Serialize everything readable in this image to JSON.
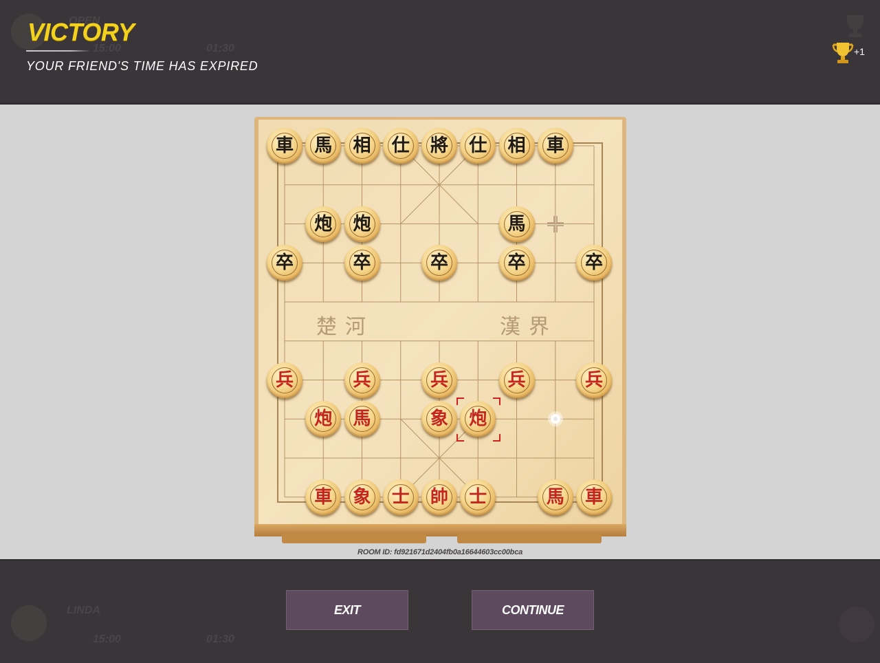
{
  "header": {
    "title": "VICTORY",
    "subtitle": "YOUR FRIEND'S TIME HAS EXPIRED",
    "trophy_reward": "+1",
    "ghost_opponent_name": "OPEN",
    "ghost_opponent_total_time": "15:00",
    "ghost_opponent_move_time": "01:30",
    "colors": {
      "title": "#f2d21e",
      "bar": "#3a3539"
    }
  },
  "board": {
    "river_left": "楚河",
    "river_right": "漢界",
    "pieces": [
      {
        "side": "black",
        "char": "車",
        "col": 0,
        "row": 0
      },
      {
        "side": "black",
        "char": "馬",
        "col": 1,
        "row": 0
      },
      {
        "side": "black",
        "char": "相",
        "col": 2,
        "row": 0
      },
      {
        "side": "black",
        "char": "仕",
        "col": 3,
        "row": 0
      },
      {
        "side": "black",
        "char": "將",
        "col": 4,
        "row": 0
      },
      {
        "side": "black",
        "char": "仕",
        "col": 5,
        "row": 0
      },
      {
        "side": "black",
        "char": "相",
        "col": 6,
        "row": 0
      },
      {
        "side": "black",
        "char": "車",
        "col": 7,
        "row": 0
      },
      {
        "side": "black",
        "char": "炮",
        "col": 1,
        "row": 2
      },
      {
        "side": "black",
        "char": "炮",
        "col": 2,
        "row": 2
      },
      {
        "side": "black",
        "char": "馬",
        "col": 6,
        "row": 2
      },
      {
        "side": "black",
        "char": "卒",
        "col": 0,
        "row": 3
      },
      {
        "side": "black",
        "char": "卒",
        "col": 2,
        "row": 3
      },
      {
        "side": "black",
        "char": "卒",
        "col": 4,
        "row": 3
      },
      {
        "side": "black",
        "char": "卒",
        "col": 6,
        "row": 3
      },
      {
        "side": "black",
        "char": "卒",
        "col": 8,
        "row": 3
      },
      {
        "side": "red",
        "char": "兵",
        "col": 0,
        "row": 6
      },
      {
        "side": "red",
        "char": "兵",
        "col": 2,
        "row": 6
      },
      {
        "side": "red",
        "char": "兵",
        "col": 4,
        "row": 6
      },
      {
        "side": "red",
        "char": "兵",
        "col": 6,
        "row": 6
      },
      {
        "side": "red",
        "char": "兵",
        "col": 8,
        "row": 6
      },
      {
        "side": "red",
        "char": "炮",
        "col": 1,
        "row": 7
      },
      {
        "side": "red",
        "char": "馬",
        "col": 2,
        "row": 7
      },
      {
        "side": "red",
        "char": "象",
        "col": 4,
        "row": 7
      },
      {
        "side": "red",
        "char": "炮",
        "col": 5,
        "row": 7
      },
      {
        "side": "red",
        "char": "車",
        "col": 1,
        "row": 9
      },
      {
        "side": "red",
        "char": "象",
        "col": 2,
        "row": 9
      },
      {
        "side": "red",
        "char": "士",
        "col": 3,
        "row": 9
      },
      {
        "side": "red",
        "char": "帥",
        "col": 4,
        "row": 9
      },
      {
        "side": "red",
        "char": "士",
        "col": 5,
        "row": 9
      },
      {
        "side": "red",
        "char": "馬",
        "col": 7,
        "row": 9
      },
      {
        "side": "red",
        "char": "車",
        "col": 8,
        "row": 9
      }
    ],
    "selected": {
      "col": 5,
      "row": 7
    },
    "last_move_from": {
      "col": 7,
      "row": 7
    },
    "opponent_marker": {
      "col": 7,
      "row": 2
    }
  },
  "room_id": "ROOM ID: fd921671d2404fb0a16644603cc00bca",
  "footer": {
    "exit_label": "EXIT",
    "continue_label": "CONTINUE",
    "ghost_player_name": "LINDA",
    "ghost_player_total_time": "15:00",
    "ghost_player_move_time": "01:30",
    "button_color": "#5e4a5e"
  }
}
